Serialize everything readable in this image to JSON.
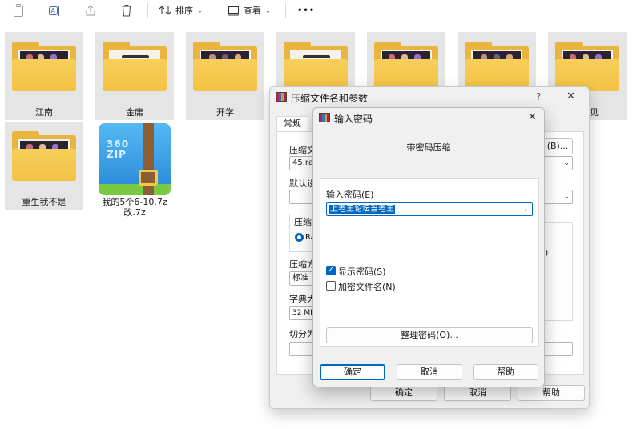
{
  "toolbar": {
    "copy_icon": "clipboard-icon",
    "rename_icon": "rename-icon",
    "share_icon": "share-icon",
    "delete_icon": "trash-icon",
    "sort_label": "排序",
    "view_label": "查看",
    "more_label": "•••"
  },
  "files": {
    "folders": [
      {
        "label": "江南"
      },
      {
        "label": "金庸"
      },
      {
        "label": "开学"
      },
      {
        "label": ""
      },
      {
        "label": ""
      },
      {
        "label": ""
      },
      {
        "label": "见"
      },
      {
        "label": "重生我不是"
      }
    ],
    "zip": {
      "line1": "我的5个6-10.7z",
      "line2": "改.7z",
      "logo_top": "360",
      "logo_bottom": "ZIP"
    }
  },
  "back_dialog": {
    "title": "压缩文件名和参数",
    "help_icon": "?",
    "close_icon": "✕",
    "tab": "常规",
    "archive_label": "压缩文",
    "archive_value": "45.rar",
    "browse_button": "(B)...",
    "default_label": "默认设",
    "format_label": "压缩",
    "format_radio": "RA",
    "method_label": "压缩方",
    "method_value": "标准",
    "dict_label": "字典大",
    "dict_value": "32 MB",
    "split_label": "切分为",
    "side_mark": ")",
    "ok_button": "确定",
    "cancel_button": "取消",
    "help_button": "帮助"
  },
  "front_dialog": {
    "title": "输入密码",
    "close_icon": "✕",
    "heading": "带密码压缩",
    "password_label": "输入密码",
    "password_key": "(E)",
    "password_value": "上老王论坛当老王",
    "show_password_label": "显示密码",
    "show_password_key": "(S)",
    "show_password_checked": true,
    "encrypt_names_label": "加密文件名",
    "encrypt_names_key": "(N)",
    "encrypt_names_checked": false,
    "organize_button": "整理密码",
    "organize_key": "(O)...",
    "ok_button": "确定",
    "cancel_button": "取消",
    "help_button": "帮助"
  },
  "colors": {
    "accent": "#0067c0",
    "folder": "#f3c243",
    "selection": "#e5e5e5"
  }
}
